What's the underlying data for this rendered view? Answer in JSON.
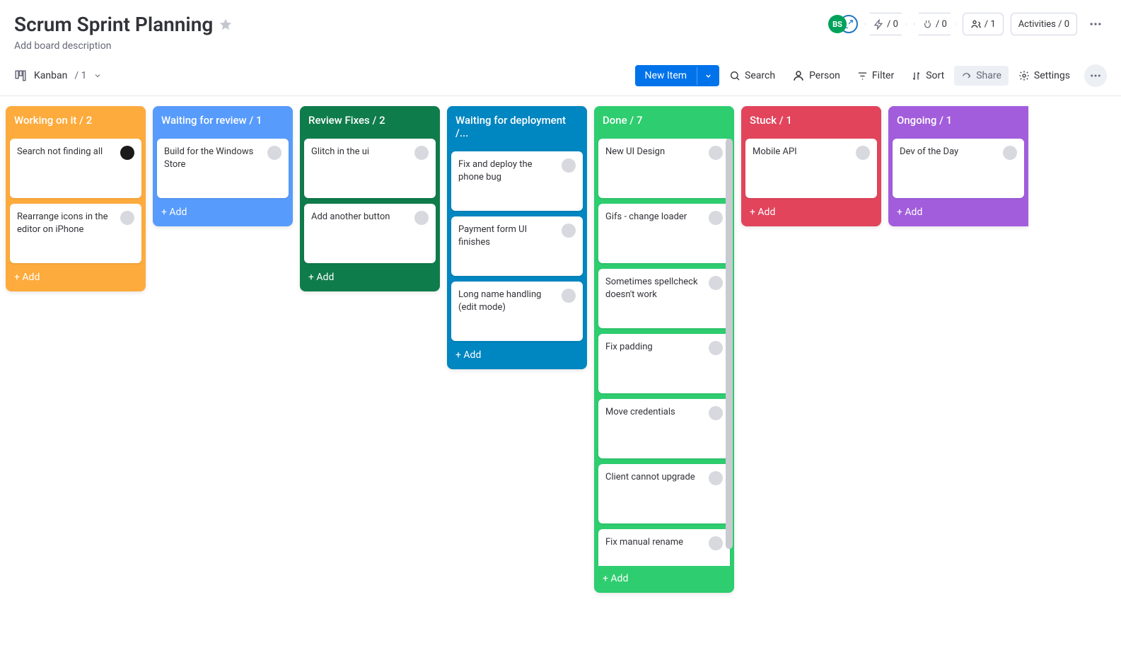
{
  "header": {
    "title": "Scrum Sprint Planning",
    "description_placeholder": "Add board description",
    "avatar_initials": "BS",
    "bolt_count": "/ 0",
    "plug_count": "/ 0",
    "members_count": "/ 1",
    "activities_label": "Activities / 0"
  },
  "toolbar": {
    "view_label": "Kanban",
    "view_count": "/ 1",
    "new_item": "New Item",
    "search": "Search",
    "person": "Person",
    "filter": "Filter",
    "sort": "Sort",
    "share": "Share",
    "settings": "Settings"
  },
  "columns": [
    {
      "title": "Working on it / 2",
      "color": "c-orange",
      "cards": [
        {
          "text": "Search not finding all",
          "avatar": "dark"
        },
        {
          "text": "Rearrange icons in the editor on iPhone",
          "avatar": "grey"
        }
      ]
    },
    {
      "title": "Waiting for review / 1",
      "color": "c-blue",
      "cards": [
        {
          "text": "Build for the Windows Store",
          "avatar": "grey"
        }
      ]
    },
    {
      "title": "Review Fixes / 2",
      "color": "c-green-dark",
      "cards": [
        {
          "text": "Glitch in the ui",
          "avatar": "grey"
        },
        {
          "text": "Add another button",
          "avatar": "grey"
        }
      ]
    },
    {
      "title": "Waiting for deployment /...",
      "color": "c-blue-dark",
      "cards": [
        {
          "text": "Fix and deploy the phone bug",
          "avatar": "grey"
        },
        {
          "text": "Payment form UI finishes",
          "avatar": "grey"
        },
        {
          "text": "Long name handling (edit mode)",
          "avatar": "grey"
        }
      ]
    },
    {
      "title": "Done / 7",
      "color": "c-green",
      "scrollable": true,
      "cards": [
        {
          "text": "New UI Design",
          "avatar": "grey"
        },
        {
          "text": "Gifs - change loader",
          "avatar": "grey"
        },
        {
          "text": "Sometimes spellcheck doesn't work",
          "avatar": "grey"
        },
        {
          "text": "Fix padding",
          "avatar": "grey"
        },
        {
          "text": "Move credentials",
          "avatar": "grey"
        },
        {
          "text": "Client cannot upgrade",
          "avatar": "grey"
        },
        {
          "text": "Fix manual rename",
          "avatar": "grey"
        }
      ]
    },
    {
      "title": "Stuck / 1",
      "color": "c-red",
      "cards": [
        {
          "text": "Mobile API",
          "avatar": "grey"
        }
      ]
    },
    {
      "title": "Ongoing / 1",
      "color": "c-purple",
      "cards": [
        {
          "text": "Dev of the Day",
          "avatar": "grey"
        }
      ]
    }
  ],
  "add_label": "+ Add"
}
